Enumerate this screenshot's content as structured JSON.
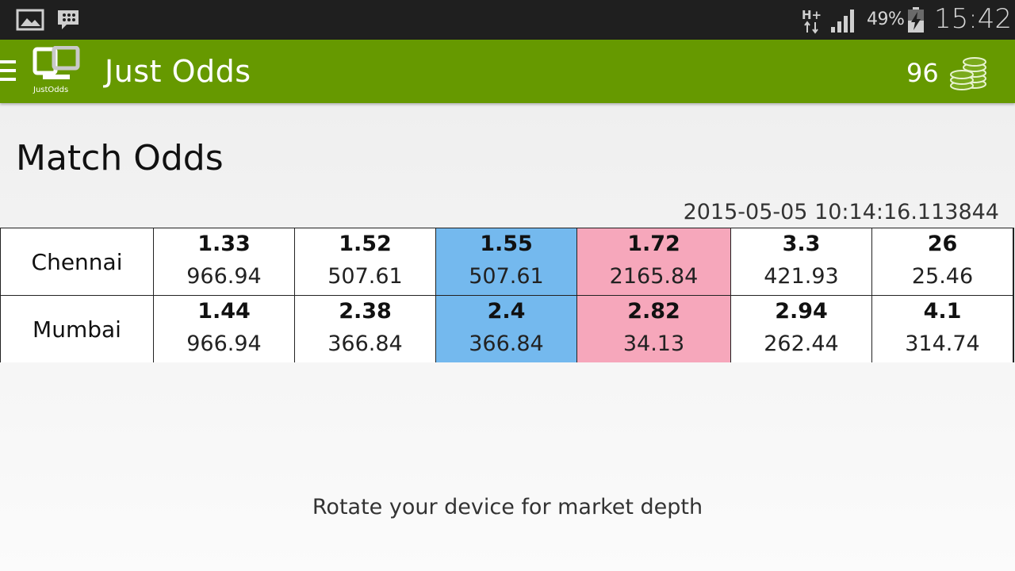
{
  "status_bar": {
    "battery": "49%",
    "time": "15:42",
    "icons": [
      "gallery-icon",
      "bbm-icon",
      "hplus-network-icon",
      "signal-icon",
      "battery-charging-icon"
    ]
  },
  "app_bar": {
    "title": "Just Odds",
    "logo_text": "JustOdds",
    "coin_count": "96",
    "icons": [
      "menu-icon",
      "coins-icon"
    ],
    "background_color": "#669900"
  },
  "main": {
    "title": "Match Odds",
    "timestamp": "2015-05-05 10:14:16.113844",
    "colors": {
      "back_highlight": "#74b9ee",
      "lay_highlight": "#f6a7bb"
    },
    "runners": [
      {
        "name": "Chennai",
        "odds": [
          {
            "price": "1.33",
            "size": "966.94"
          },
          {
            "price": "1.52",
            "size": "507.61"
          },
          {
            "price": "1.55",
            "size": "507.61"
          },
          {
            "price": "1.72",
            "size": "2165.84"
          },
          {
            "price": "3.3",
            "size": "421.93"
          },
          {
            "price": "26",
            "size": "25.46"
          }
        ]
      },
      {
        "name": "Mumbai",
        "odds": [
          {
            "price": "1.44",
            "size": "966.94"
          },
          {
            "price": "2.38",
            "size": "366.84"
          },
          {
            "price": "2.4",
            "size": "366.84"
          },
          {
            "price": "2.82",
            "size": "34.13"
          },
          {
            "price": "2.94",
            "size": "262.44"
          },
          {
            "price": "4.1",
            "size": "314.74"
          }
        ]
      }
    ],
    "hint": "Rotate your device for market depth"
  }
}
